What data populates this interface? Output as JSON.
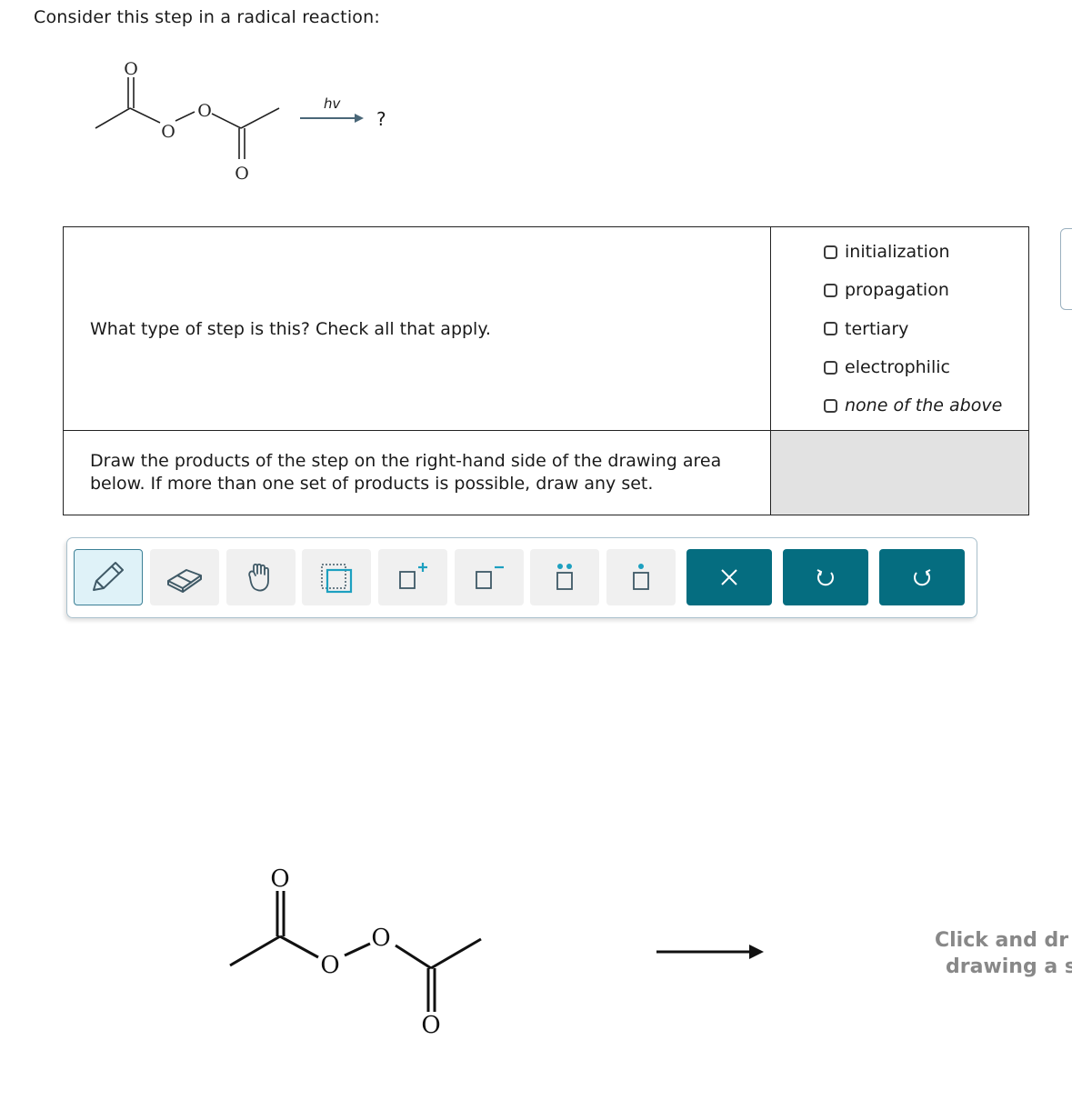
{
  "prompt": "Consider this step in a radical reaction:",
  "reaction": {
    "condition": "hv",
    "product": "?",
    "atoms": {
      "o_top": "O",
      "o_ester1": "O",
      "o_ester2": "O",
      "o_bottom": "O"
    }
  },
  "question1": {
    "text": "What type of step is this? Check all that apply.",
    "options": [
      {
        "label": "initialization",
        "checked": false
      },
      {
        "label": "propagation",
        "checked": false
      },
      {
        "label": "tertiary",
        "checked": false
      },
      {
        "label": "electrophilic",
        "checked": false
      },
      {
        "label": "none of the above",
        "checked": false,
        "italic": true
      }
    ]
  },
  "question2": {
    "text": "Draw the products of the step on the right-hand side of the drawing area below. If more than one set of products is possible, draw any set."
  },
  "toolbar": {
    "tools": [
      "pencil-icon",
      "eraser-icon",
      "hand-icon",
      "select-box-icon",
      "add-charge-plus-icon",
      "add-charge-minus-icon",
      "lone-pair-icon",
      "radical-icon",
      "clear-icon",
      "undo-icon",
      "redo-icon"
    ],
    "active_tool": "pencil-icon",
    "accent_color": "#056d80"
  },
  "canvas": {
    "atoms": {
      "o_top": "O",
      "o_ester1": "O",
      "o_ester2": "O",
      "o_bottom": "O"
    },
    "hint_line1": "Click and dr",
    "hint_line2": "drawing a s"
  }
}
